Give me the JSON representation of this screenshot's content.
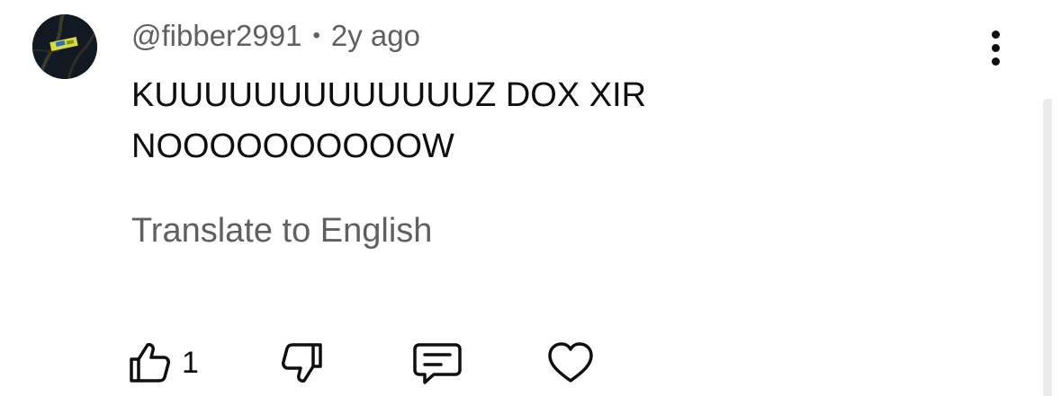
{
  "comment": {
    "author": "@fibber2991",
    "separator": "•",
    "timestamp": "2y ago",
    "text_lines": [
      "KUUUUUUUUUUUUUZ DOX XIR",
      "NOOOOOOOOOOW"
    ],
    "translate_label": "Translate to English",
    "like_count": "1"
  },
  "icons": {
    "avatar": "avatar-image",
    "more": "more-vertical-icon",
    "like": "thumbs-up-icon",
    "dislike": "thumbs-down-icon",
    "reply": "reply-comment-icon",
    "heart": "heart-icon"
  },
  "colors": {
    "text_primary": "#0f0f0f",
    "text_secondary": "#606060",
    "background": "#ffffff"
  }
}
